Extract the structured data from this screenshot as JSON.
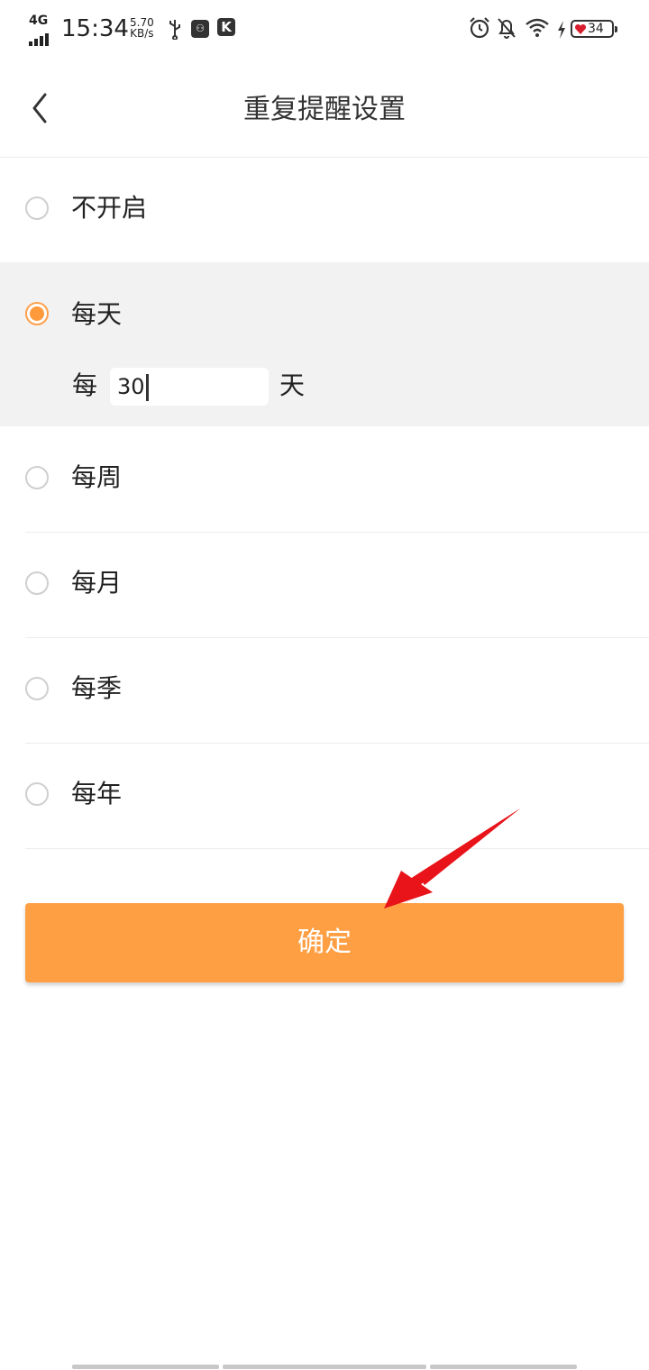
{
  "status_bar": {
    "network": "4G",
    "time": "15:34",
    "speed_value": "5.70",
    "speed_unit": "KB/s",
    "k_icon": "K",
    "battery": "34",
    "icons": [
      "signal-icon",
      "usb-icon",
      "app-icon",
      "k-app-icon",
      "alarm-icon",
      "notifications-off-icon",
      "wifi-icon",
      "charging-icon",
      "battery-icon"
    ]
  },
  "header": {
    "title": "重复提醒设置",
    "back_icon": "chevron-left-icon"
  },
  "options": [
    {
      "label": "不开启",
      "checked": false
    },
    {
      "label": "每天",
      "checked": true
    },
    {
      "label": "每周",
      "checked": false
    },
    {
      "label": "每月",
      "checked": false
    },
    {
      "label": "每季",
      "checked": false
    },
    {
      "label": "每年",
      "checked": false
    }
  ],
  "interval": {
    "prefix": "每",
    "value": "30",
    "suffix": "天"
  },
  "confirm_label": "确定",
  "colors": {
    "accent": "#ff9f44",
    "selected_bg": "#f2f2f2",
    "annotation_arrow": "#e8141a"
  }
}
